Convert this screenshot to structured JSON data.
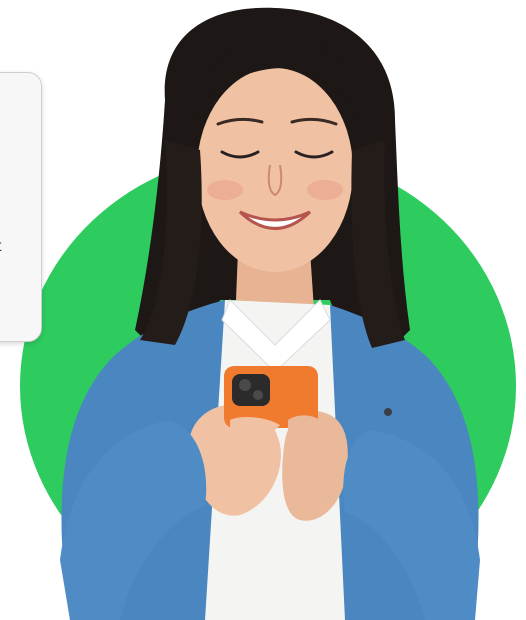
{
  "card": {
    "visible_text": "t"
  },
  "colors": {
    "accent_circle": "#2ecc5f",
    "cardigan": "#4a86c0",
    "phone_case": "#f07a2e",
    "shirt": "#f4f4f2",
    "hair": "#1d1816",
    "skin": "#f0c2a3",
    "card_background": "#f7f7f7"
  },
  "icons": {
    "phone": "smartphone-icon"
  }
}
